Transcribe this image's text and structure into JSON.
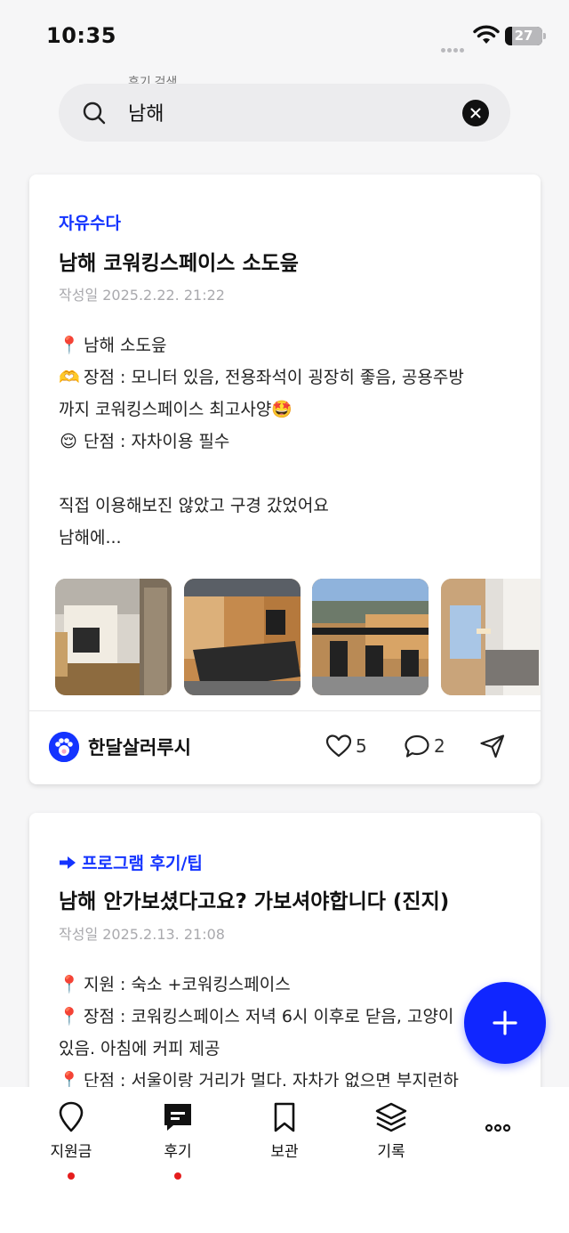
{
  "status_bar": {
    "time": "10:35",
    "battery": "27"
  },
  "search": {
    "label": "후기 검색",
    "value": "남해"
  },
  "posts": [
    {
      "category": "자유수다",
      "title": "남해 코워킹스페이스 소도읖",
      "date": "작성일 2025.2.22. 21:22",
      "lines": [
        {
          "emoji": "📍",
          "text": "남해 소도읖"
        },
        {
          "emoji": "🫶",
          "text": "장점 : 모니터 있음, 전용좌석이 굉장히 좋음, 공용주방"
        },
        {
          "emoji": "",
          "text": "까지 코워킹스페이스 최고사양🤩"
        },
        {
          "emoji": "😌",
          "text": "단점 : 자차이용 필수"
        },
        {
          "emoji": "",
          "text": ""
        },
        {
          "emoji": "",
          "text": "직접 이용해보진 않았고 구경 갔었어요"
        },
        {
          "emoji": "",
          "text": "남해에..."
        }
      ],
      "author": "한달살러루시",
      "likes": "5",
      "comments": "2"
    },
    {
      "category": "프로그램 후기/팁",
      "title": "남해 안가보셨다고요? 가보셔야합니다 (진지)",
      "date": "작성일 2025.2.13. 21:08",
      "lines": [
        {
          "emoji": "📍",
          "text": "지원 : 숙소 +코워킹스페이스"
        },
        {
          "emoji": "📍",
          "text": "장점 : 코워킹스페이스 저녁 6시 이후로 닫음, 고양이"
        },
        {
          "emoji": "",
          "text": "있음. 아침에 커피 제공"
        },
        {
          "emoji": "📍",
          "text": "단점 : 서울이랑 거리가 멀다. 자차가 없으면 부지런하"
        }
      ]
    }
  ],
  "nav": [
    {
      "label": "지원금",
      "icon": "map-pin-icon",
      "dot": true
    },
    {
      "label": "후기",
      "icon": "chat-bubble-icon",
      "dot": true
    },
    {
      "label": "보관",
      "icon": "bookmark-icon",
      "dot": false
    },
    {
      "label": "기록",
      "icon": "layers-icon",
      "dot": false
    },
    {
      "label": "",
      "icon": "more-icon",
      "dot": false
    }
  ],
  "colors": {
    "accent": "#1434ff",
    "fab": "#1026ff",
    "badge_dot": "#e51d1d"
  }
}
